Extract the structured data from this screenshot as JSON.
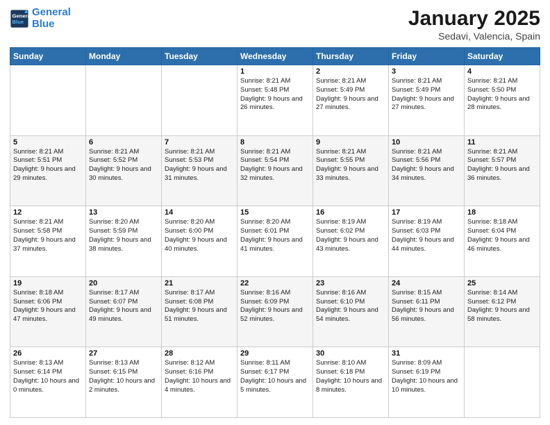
{
  "header": {
    "logo_line1": "General",
    "logo_line2": "Blue",
    "month": "January 2025",
    "location": "Sedavi, Valencia, Spain"
  },
  "weekdays": [
    "Sunday",
    "Monday",
    "Tuesday",
    "Wednesday",
    "Thursday",
    "Friday",
    "Saturday"
  ],
  "weeks": [
    [
      {
        "day": "",
        "info": ""
      },
      {
        "day": "",
        "info": ""
      },
      {
        "day": "",
        "info": ""
      },
      {
        "day": "1",
        "info": "Sunrise: 8:21 AM\nSunset: 5:48 PM\nDaylight: 9 hours and 26 minutes."
      },
      {
        "day": "2",
        "info": "Sunrise: 8:21 AM\nSunset: 5:49 PM\nDaylight: 9 hours and 27 minutes."
      },
      {
        "day": "3",
        "info": "Sunrise: 8:21 AM\nSunset: 5:49 PM\nDaylight: 9 hours and 27 minutes."
      },
      {
        "day": "4",
        "info": "Sunrise: 8:21 AM\nSunset: 5:50 PM\nDaylight: 9 hours and 28 minutes."
      }
    ],
    [
      {
        "day": "5",
        "info": "Sunrise: 8:21 AM\nSunset: 5:51 PM\nDaylight: 9 hours and 29 minutes."
      },
      {
        "day": "6",
        "info": "Sunrise: 8:21 AM\nSunset: 5:52 PM\nDaylight: 9 hours and 30 minutes."
      },
      {
        "day": "7",
        "info": "Sunrise: 8:21 AM\nSunset: 5:53 PM\nDaylight: 9 hours and 31 minutes."
      },
      {
        "day": "8",
        "info": "Sunrise: 8:21 AM\nSunset: 5:54 PM\nDaylight: 9 hours and 32 minutes."
      },
      {
        "day": "9",
        "info": "Sunrise: 8:21 AM\nSunset: 5:55 PM\nDaylight: 9 hours and 33 minutes."
      },
      {
        "day": "10",
        "info": "Sunrise: 8:21 AM\nSunset: 5:56 PM\nDaylight: 9 hours and 34 minutes."
      },
      {
        "day": "11",
        "info": "Sunrise: 8:21 AM\nSunset: 5:57 PM\nDaylight: 9 hours and 36 minutes."
      }
    ],
    [
      {
        "day": "12",
        "info": "Sunrise: 8:21 AM\nSunset: 5:58 PM\nDaylight: 9 hours and 37 minutes."
      },
      {
        "day": "13",
        "info": "Sunrise: 8:20 AM\nSunset: 5:59 PM\nDaylight: 9 hours and 38 minutes."
      },
      {
        "day": "14",
        "info": "Sunrise: 8:20 AM\nSunset: 6:00 PM\nDaylight: 9 hours and 40 minutes."
      },
      {
        "day": "15",
        "info": "Sunrise: 8:20 AM\nSunset: 6:01 PM\nDaylight: 9 hours and 41 minutes."
      },
      {
        "day": "16",
        "info": "Sunrise: 8:19 AM\nSunset: 6:02 PM\nDaylight: 9 hours and 43 minutes."
      },
      {
        "day": "17",
        "info": "Sunrise: 8:19 AM\nSunset: 6:03 PM\nDaylight: 9 hours and 44 minutes."
      },
      {
        "day": "18",
        "info": "Sunrise: 8:18 AM\nSunset: 6:04 PM\nDaylight: 9 hours and 46 minutes."
      }
    ],
    [
      {
        "day": "19",
        "info": "Sunrise: 8:18 AM\nSunset: 6:06 PM\nDaylight: 9 hours and 47 minutes."
      },
      {
        "day": "20",
        "info": "Sunrise: 8:17 AM\nSunset: 6:07 PM\nDaylight: 9 hours and 49 minutes."
      },
      {
        "day": "21",
        "info": "Sunrise: 8:17 AM\nSunset: 6:08 PM\nDaylight: 9 hours and 51 minutes."
      },
      {
        "day": "22",
        "info": "Sunrise: 8:16 AM\nSunset: 6:09 PM\nDaylight: 9 hours and 52 minutes."
      },
      {
        "day": "23",
        "info": "Sunrise: 8:16 AM\nSunset: 6:10 PM\nDaylight: 9 hours and 54 minutes."
      },
      {
        "day": "24",
        "info": "Sunrise: 8:15 AM\nSunset: 6:11 PM\nDaylight: 9 hours and 56 minutes."
      },
      {
        "day": "25",
        "info": "Sunrise: 8:14 AM\nSunset: 6:12 PM\nDaylight: 9 hours and 58 minutes."
      }
    ],
    [
      {
        "day": "26",
        "info": "Sunrise: 8:13 AM\nSunset: 6:14 PM\nDaylight: 10 hours and 0 minutes."
      },
      {
        "day": "27",
        "info": "Sunrise: 8:13 AM\nSunset: 6:15 PM\nDaylight: 10 hours and 2 minutes."
      },
      {
        "day": "28",
        "info": "Sunrise: 8:12 AM\nSunset: 6:16 PM\nDaylight: 10 hours and 4 minutes."
      },
      {
        "day": "29",
        "info": "Sunrise: 8:11 AM\nSunset: 6:17 PM\nDaylight: 10 hours and 5 minutes."
      },
      {
        "day": "30",
        "info": "Sunrise: 8:10 AM\nSunset: 6:18 PM\nDaylight: 10 hours and 8 minutes."
      },
      {
        "day": "31",
        "info": "Sunrise: 8:09 AM\nSunset: 6:19 PM\nDaylight: 10 hours and 10 minutes."
      },
      {
        "day": "",
        "info": ""
      }
    ]
  ]
}
